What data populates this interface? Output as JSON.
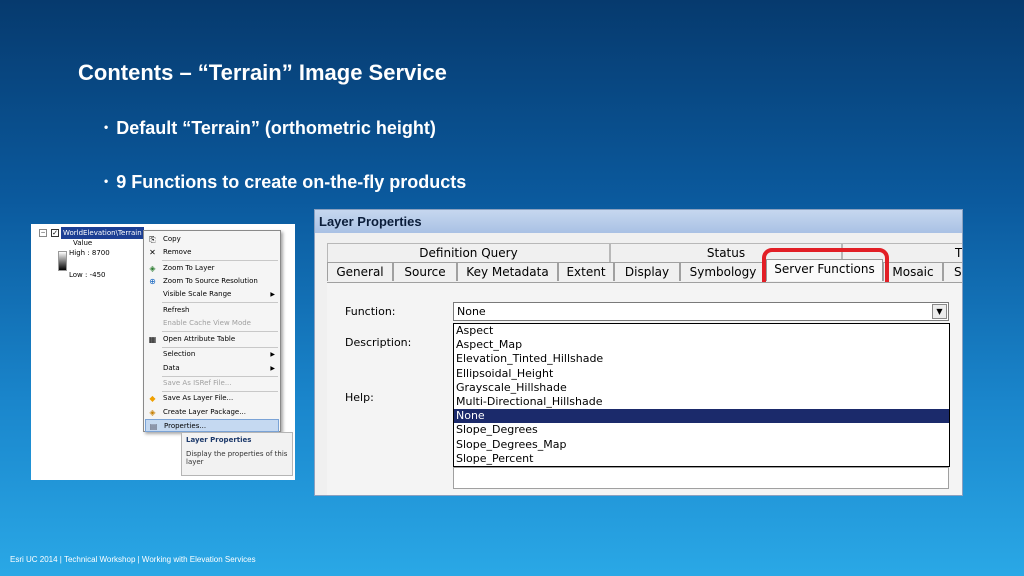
{
  "slide": {
    "title": "Contents – “Terrain” Image Service",
    "bullets": [
      "Default “Terrain”  (orthometric height)",
      "9 Functions to create on-the-fly products"
    ],
    "footer": "Esri UC 2014 | Technical Workshop |  Working with Elevation Services"
  },
  "toc": {
    "layer_name": "WorldElevation\\Terrain",
    "legend_value_label": "Value",
    "legend_high": "High : 8700",
    "legend_low": "Low : -450",
    "context_menu": [
      {
        "label": "Copy",
        "icon": "copy-icon",
        "enabled": true
      },
      {
        "label": "Remove",
        "icon": "remove-icon",
        "enabled": true
      },
      {
        "label": "Zoom To Layer",
        "icon": "zoom-to-layer-icon",
        "enabled": true
      },
      {
        "label": "Zoom To Source Resolution",
        "icon": "zoom-resolution-icon",
        "enabled": true
      },
      {
        "label": "Visible Scale Range",
        "icon": "",
        "enabled": true,
        "submenu": true
      },
      {
        "label": "Refresh",
        "icon": "",
        "enabled": true
      },
      {
        "label": "Enable Cache View Mode",
        "icon": "",
        "enabled": false
      },
      {
        "label": "Open Attribute Table",
        "icon": "table-icon",
        "enabled": true
      },
      {
        "label": "Selection",
        "icon": "",
        "enabled": true,
        "submenu": true
      },
      {
        "label": "Data",
        "icon": "",
        "enabled": true,
        "submenu": true
      },
      {
        "label": "Save As ISRef File...",
        "icon": "",
        "enabled": false
      },
      {
        "label": "Save As Layer File...",
        "icon": "layer-file-icon",
        "enabled": true
      },
      {
        "label": "Create Layer Package...",
        "icon": "package-icon",
        "enabled": true
      },
      {
        "label": "Properties...",
        "icon": "properties-icon",
        "enabled": true,
        "selected": true
      }
    ],
    "tooltip": {
      "title": "Layer Properties",
      "text": "Display the properties of this layer"
    }
  },
  "dialog": {
    "title": "Layer Properties",
    "tabs_back": [
      "Definition Query",
      "Status",
      "Tim"
    ],
    "tabs_front": [
      "General",
      "Source",
      "Key Metadata",
      "Extent",
      "Display",
      "Symbology",
      "Server Functions",
      "Mosaic",
      "S"
    ],
    "active_tab": "Server Functions",
    "function_label": "Function:",
    "description_label": "Description:",
    "help_label": "Help:",
    "function_value": "None",
    "function_options": [
      "Aspect",
      "Aspect_Map",
      "Elevation_Tinted_Hillshade",
      "Ellipsoidal_Height",
      "Grayscale_Hillshade",
      "Multi-Directional_Hillshade",
      "None",
      "Slope_Degrees",
      "Slope_Degrees_Map",
      "Slope_Percent"
    ],
    "selected_option": "None",
    "highlight_color": "#e21f26"
  }
}
